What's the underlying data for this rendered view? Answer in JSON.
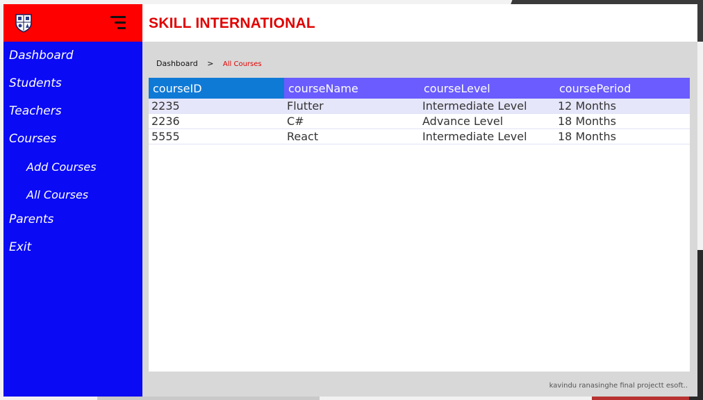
{
  "app": {
    "brand": "SKILL INTERNATIONAL",
    "footer_note": "kavindu ranasinghe final projectt esoft.."
  },
  "sidebar": {
    "items": [
      {
        "label": "Dashboard"
      },
      {
        "label": "Students"
      },
      {
        "label": "Teachers"
      },
      {
        "label": "Courses"
      },
      {
        "label": "Add Courses"
      },
      {
        "label": "All Courses"
      },
      {
        "label": "Parents"
      },
      {
        "label": "Exit"
      }
    ]
  },
  "breadcrumb": {
    "root": "Dashboard",
    "separator": ">",
    "current": "All Courses"
  },
  "table": {
    "columns": [
      "courseID",
      "courseName",
      "courseLevel",
      "coursePeriod"
    ],
    "rows": [
      [
        "2235",
        "Flutter",
        "Intermediate Level",
        "12 Months"
      ],
      [
        "2236",
        "C#",
        "Advance Level",
        "18 Months"
      ],
      [
        "5555",
        "React",
        "Intermediate Level",
        "18 Months"
      ]
    ]
  },
  "colors": {
    "sidebar": "#0a0af5",
    "logo_bar": "#ff0000",
    "brand": "#e00000",
    "header_cell": "#6a5cff",
    "header_cell_selected": "#0f7ad6"
  },
  "icons": {
    "logo": "school-crest-icon",
    "menu": "hamburger-menu-icon"
  }
}
